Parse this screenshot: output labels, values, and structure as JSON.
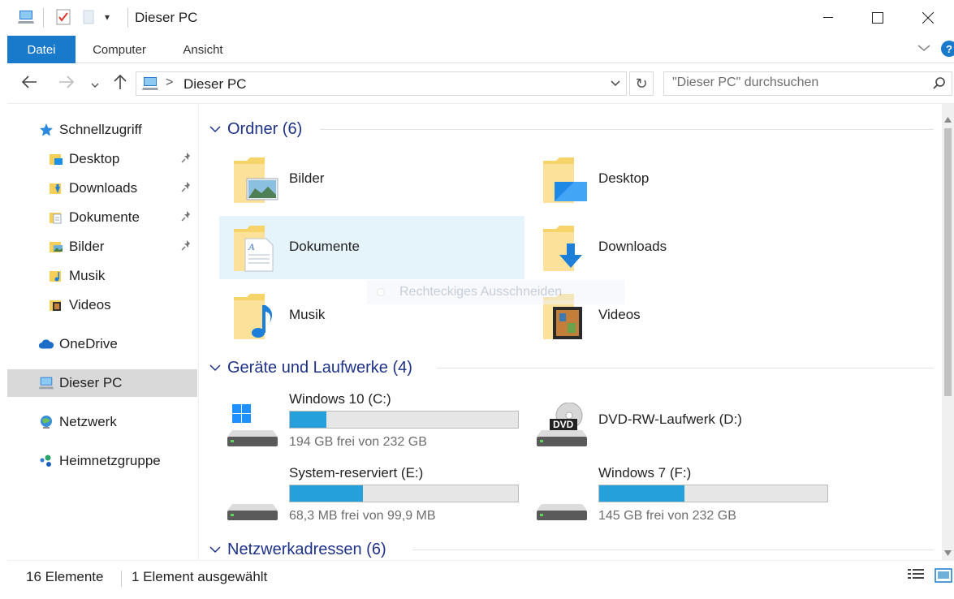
{
  "window": {
    "title": "Dieser PC",
    "minimize": "—",
    "maximize": "☐",
    "close": "✕"
  },
  "ribbon": {
    "tabs": [
      "Datei",
      "Computer",
      "Ansicht"
    ],
    "expand": "∨",
    "help": "?"
  },
  "nav": {
    "back": "←",
    "forward": "→",
    "recent": "∨",
    "up": "↑",
    "breadcrumb_sep": ">",
    "address": "Dieser PC",
    "address_dropdown": "∨",
    "refresh": "↻",
    "search_placeholder": "\"Dieser PC\" durchsuchen"
  },
  "sidebar": {
    "quick_access": "Schnellzugriff",
    "quick_items": [
      {
        "label": "Desktop",
        "icon": "desktop-folder-icon"
      },
      {
        "label": "Downloads",
        "icon": "downloads-folder-icon"
      },
      {
        "label": "Dokumente",
        "icon": "documents-folder-icon"
      },
      {
        "label": "Bilder",
        "icon": "pictures-folder-icon"
      },
      {
        "label": "Musik",
        "icon": "music-folder-icon"
      },
      {
        "label": "Videos",
        "icon": "videos-folder-icon"
      }
    ],
    "onedrive": "OneDrive",
    "thispc": "Dieser PC",
    "network": "Netzwerk",
    "homegroup": "Heimnetzgruppe",
    "pin": "📌"
  },
  "content": {
    "folders_header": "Ordner (6)",
    "folders": [
      "Bilder",
      "Desktop",
      "Dokumente",
      "Downloads",
      "Musik",
      "Videos"
    ],
    "drives_header": "Geräte und Laufwerke (4)",
    "drives": [
      {
        "name": "Windows 10 (C:)",
        "info": "194 GB frei von 232 GB",
        "used": 0.16
      },
      {
        "name": "DVD-RW-Laufwerk (D:)",
        "info": "",
        "used": null
      },
      {
        "name": "System-reserviert (E:)",
        "info": "68,3 MB frei von 99,9 MB",
        "used": 0.32
      },
      {
        "name": "Windows 7 (F:)",
        "info": "145 GB frei von 232 GB",
        "used": 0.375
      }
    ],
    "network_header": "Netzwerkadressen (6)",
    "dvd_label": "DVD"
  },
  "overlay": {
    "ghost_text": "Rechteckiges Ausschneiden"
  },
  "status": {
    "count": "16 Elemente",
    "selected": "1 Element ausgewählt"
  },
  "colors": {
    "accent": "#1979ca",
    "drive_fill": "#26a0da",
    "header_text": "#1e3287",
    "selection": "#e5f3fb"
  }
}
